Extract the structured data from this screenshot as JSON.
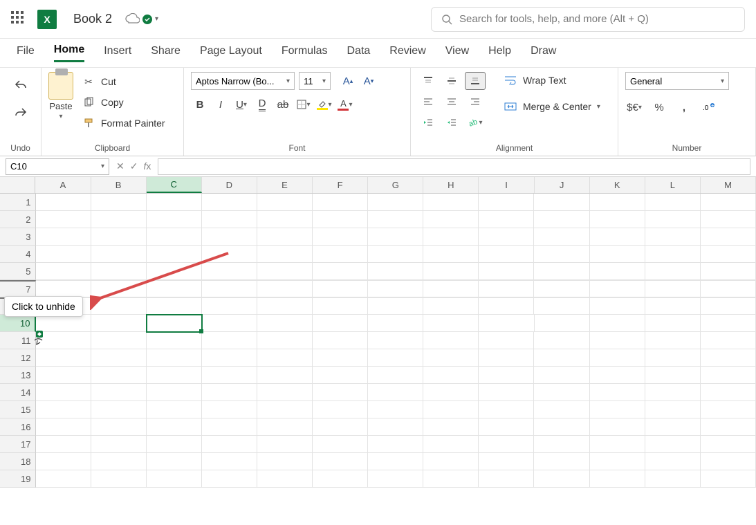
{
  "title": {
    "doc_name": "Book 2"
  },
  "search": {
    "placeholder": "Search for tools, help, and more (Alt + Q)"
  },
  "menu": {
    "tabs": [
      "File",
      "Home",
      "Insert",
      "Share",
      "Page Layout",
      "Formulas",
      "Data",
      "Review",
      "View",
      "Help",
      "Draw"
    ],
    "active": "Home"
  },
  "ribbon": {
    "undo": {
      "label": "Undo"
    },
    "clipboard": {
      "paste": "Paste",
      "cut": "Cut",
      "copy": "Copy",
      "format_painter": "Format Painter",
      "label": "Clipboard"
    },
    "font": {
      "name": "Aptos Narrow (Bo...",
      "size": "11",
      "label": "Font"
    },
    "alignment": {
      "wrap": "Wrap Text",
      "merge": "Merge & Center",
      "label": "Alignment"
    },
    "number": {
      "format": "General",
      "label": "Number"
    }
  },
  "formula_bar": {
    "cell_ref": "C10",
    "formula": ""
  },
  "grid": {
    "columns": [
      "A",
      "B",
      "C",
      "D",
      "E",
      "F",
      "G",
      "H",
      "I",
      "J",
      "K",
      "L",
      "M"
    ],
    "visible_rows": [
      1,
      2,
      3,
      4,
      5,
      7,
      9,
      10,
      11,
      12,
      13,
      14,
      15,
      16,
      17,
      18,
      19
    ],
    "selected_cell": "C10",
    "selected_col": "C",
    "selected_row": 10,
    "hidden_after_rows": [
      5,
      7
    ]
  },
  "tooltip": {
    "text": "Click to unhide"
  }
}
